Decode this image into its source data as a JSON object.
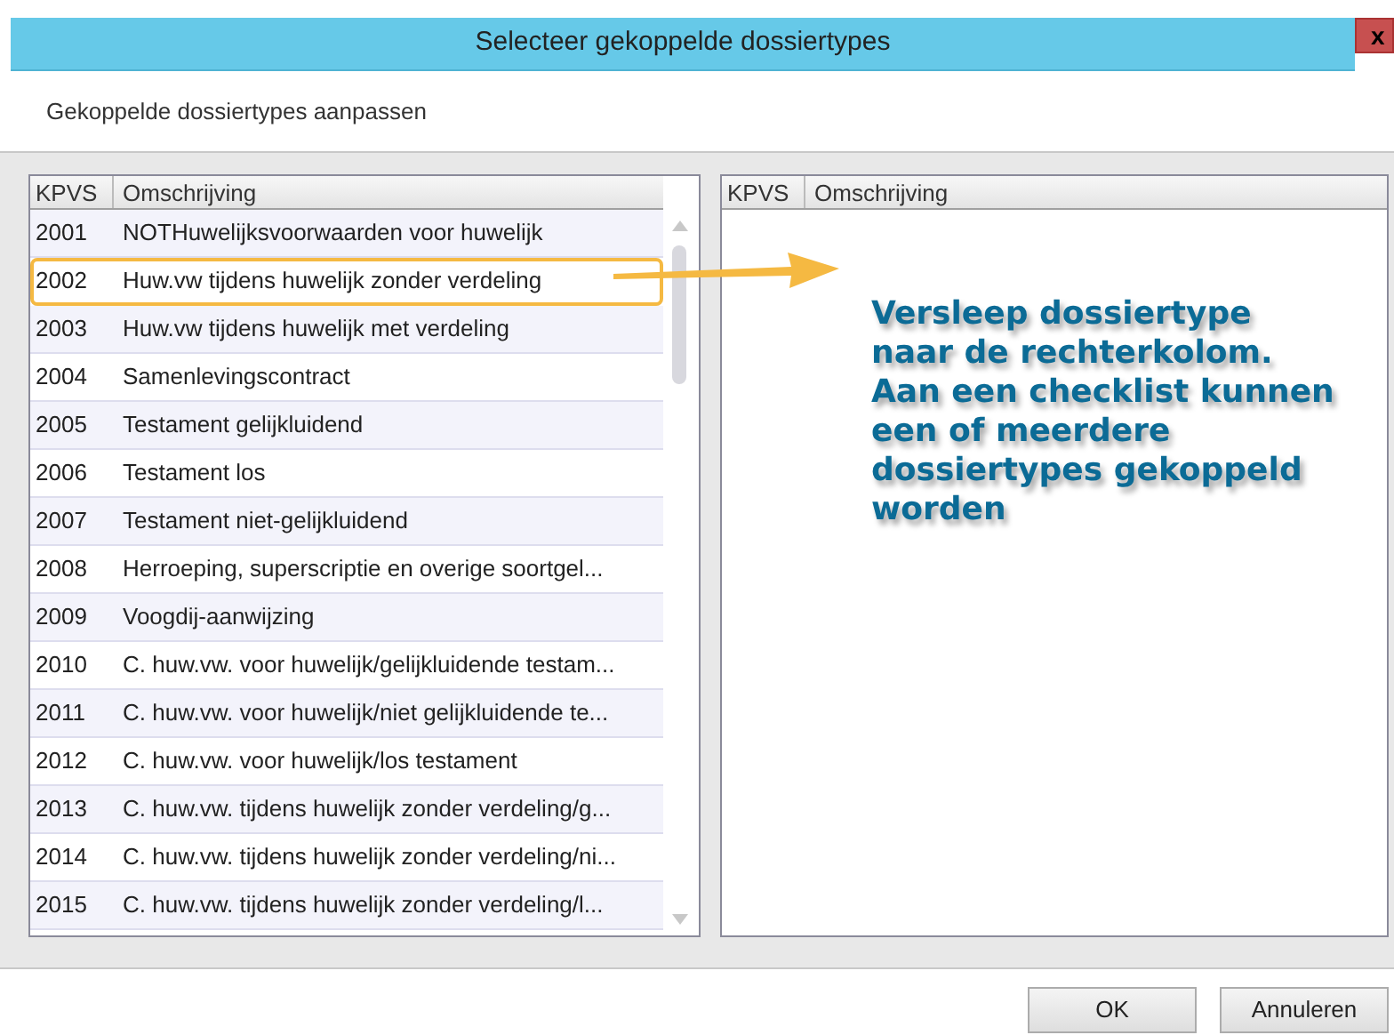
{
  "window": {
    "title": "Selecteer gekoppelde dossiertypes",
    "close": "x"
  },
  "subtitle": "Gekoppelde dossiertypes aanpassen",
  "left_list": {
    "columns": [
      "KPVS",
      "Omschrijving"
    ],
    "rows": [
      {
        "code": "2001",
        "description": "NOTHuwelijksvoorwaarden voor huwelijk",
        "selected": false
      },
      {
        "code": "2002",
        "description": "Huw.vw tijdens huwelijk zonder verdeling",
        "selected": true
      },
      {
        "code": "2003",
        "description": "Huw.vw tijdens huwelijk met verdeling",
        "selected": false
      },
      {
        "code": "2004",
        "description": "Samenlevingscontract",
        "selected": false
      },
      {
        "code": "2005",
        "description": "Testament gelijkluidend",
        "selected": false
      },
      {
        "code": "2006",
        "description": "Testament los",
        "selected": false
      },
      {
        "code": "2007",
        "description": "Testament niet-gelijkluidend",
        "selected": false
      },
      {
        "code": "2008",
        "description": "Herroeping, superscriptie en overige soortgel...",
        "selected": false
      },
      {
        "code": "2009",
        "description": "Voogdij-aanwijzing",
        "selected": false
      },
      {
        "code": "2010",
        "description": "C. huw.vw. voor huwelijk/gelijkluidende testam...",
        "selected": false
      },
      {
        "code": "2011",
        "description": "C. huw.vw. voor huwelijk/niet gelijkluidende te...",
        "selected": false
      },
      {
        "code": "2012",
        "description": "C. huw.vw. voor huwelijk/los testament",
        "selected": false
      },
      {
        "code": "2013",
        "description": "C. huw.vw. tijdens huwelijk zonder verdeling/g...",
        "selected": false
      },
      {
        "code": "2014",
        "description": "C. huw.vw. tijdens huwelijk zonder verdeling/ni...",
        "selected": false
      },
      {
        "code": "2015",
        "description": "C. huw.vw. tijdens huwelijk zonder verdeling/l...",
        "selected": false
      }
    ]
  },
  "right_list": {
    "columns": [
      "KPVS",
      "Omschrijving"
    ]
  },
  "callout": "Versleep dossiertype naar de rechterkolom. Aan een checklist kunnen een of meerdere dossiertypes gekoppeld worden",
  "buttons": [
    "OK",
    "Annuleren"
  ]
}
